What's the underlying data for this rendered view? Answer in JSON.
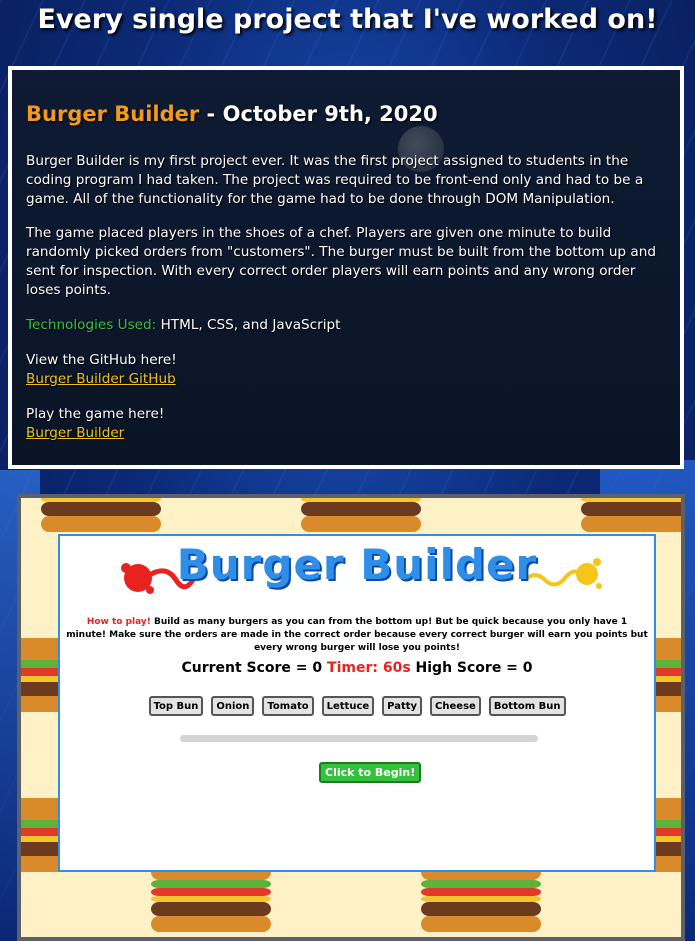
{
  "page": {
    "title": "Every single project that I've worked on!"
  },
  "project": {
    "name": "Burger Builder",
    "date": " - October 9th, 2020",
    "paragraph1": "Burger Builder is my first project ever. It was the first project assigned to students in the coding program I had taken. The project was required to be front-end only and had to be a game. All of the functionality for the game had to be done through DOM Manipulation.",
    "paragraph2": "The game placed players in the shoes of a chef. Players are given one minute to build randomly picked orders from \"customers\". The burger must be built from the bottom up and sent for inspection. With every correct order players will earn points and any wrong order loses points.",
    "tech_label": "Technologies Used:",
    "tech_value": " HTML, CSS, and JavaScript",
    "github_prompt": "View the GitHub here!",
    "github_link": "Burger Builder GitHub",
    "play_prompt": "Play the game here!",
    "play_link": "Burger Builder"
  },
  "game": {
    "logo": "Burger Builder",
    "howto_label": "How to play!",
    "howto_text": " Build as many burgers as you can from the bottom up! But be quick because you only have 1 minute! Make sure the orders are made in the correct order because every correct burger will earn you points but every wrong burger will lose you points!",
    "score_label": "Current Score = 0",
    "timer_label": "Timer: 60s",
    "high_score_label": "High Score = 0",
    "ingredients": [
      "Top Bun",
      "Onion",
      "Tomato",
      "Lettuce",
      "Patty",
      "Cheese",
      "Bottom Bun"
    ],
    "begin_label": "Click to Begin!",
    "progress": 0
  },
  "colors": {
    "accent_orange": "#f29a1b",
    "link_yellow": "#f2c21b",
    "tech_green": "#3cc043",
    "game_blue": "#2f8fe8",
    "timer_red": "#e8231f"
  }
}
